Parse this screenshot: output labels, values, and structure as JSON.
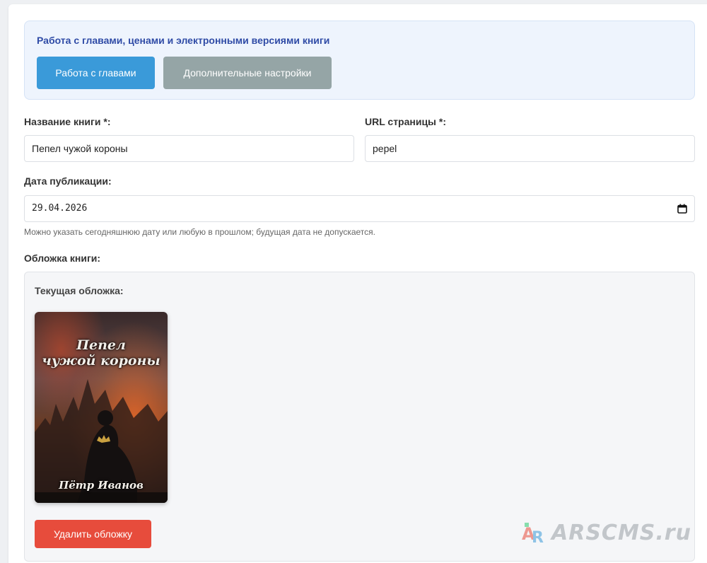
{
  "toolbar": {
    "title": "Работа с главами, ценами и электронными версиями книги",
    "chapters_button": "Работа с главами",
    "advanced_button": "Дополнительные настройки"
  },
  "form": {
    "book_title_label": "Название книги *:",
    "book_title_value": "Пепел чужой короны",
    "url_label": "URL страницы *:",
    "url_value": "pepel",
    "date_label": "Дата публикации:",
    "date_value": "29.04.2026",
    "date_hint": "Можно указать сегодняшнюю дату или любую в прошлом; будущая дата не допускается.",
    "cover_label": "Обложка книги:"
  },
  "cover": {
    "current_label": "Текущая обложка:",
    "image_title_line1": "Пепел",
    "image_title_line2": "чужой короны",
    "image_author": "Пётр Иванов",
    "delete_button": "Удалить обложку"
  },
  "watermark": {
    "text": "ARSCMS.ru"
  },
  "colors": {
    "primary_button": "#3a9ad9",
    "secondary_button": "#95a5a6",
    "danger_button": "#e74c3c",
    "toolbar_title": "#2f4ba6"
  },
  "icons": {
    "calendar": "calendar-icon",
    "watermark_logo": "ar-logo-icon"
  }
}
